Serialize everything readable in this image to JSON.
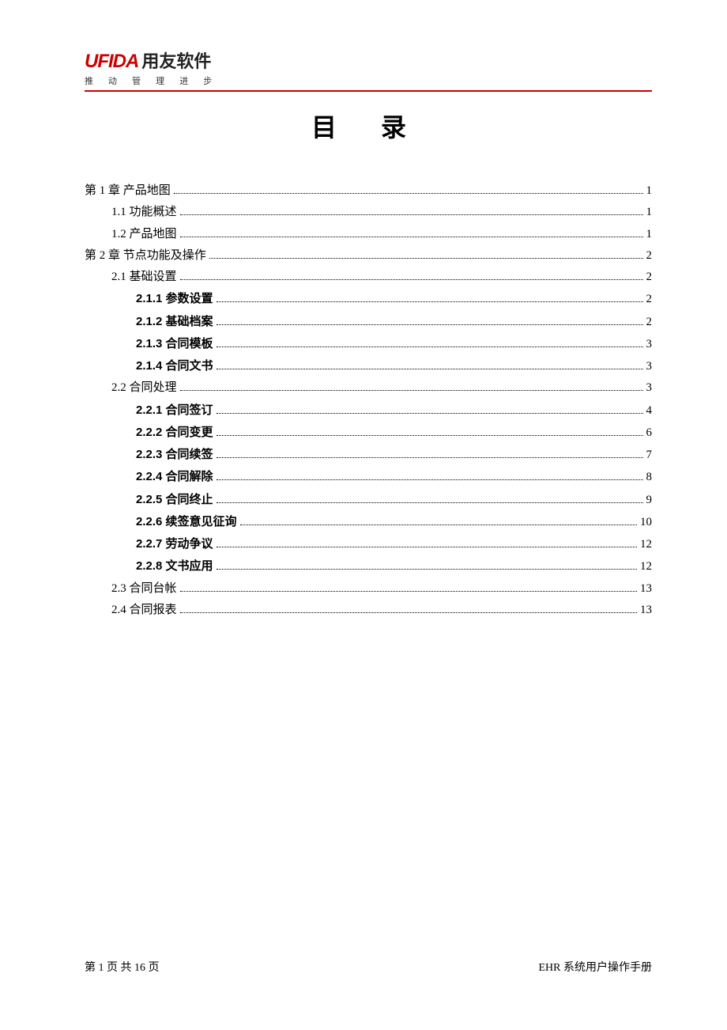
{
  "logo": {
    "en": "UFIDA",
    "cn": "用友软件",
    "subtitle": "推 动 管 理 进 步"
  },
  "title": "目 录",
  "toc": [
    {
      "level": 0,
      "label": "第 1 章  产品地图",
      "page": "1"
    },
    {
      "level": 1,
      "label": "1.1 功能概述",
      "page": "1"
    },
    {
      "level": 1,
      "label": "1.2 产品地图",
      "page": "1"
    },
    {
      "level": 0,
      "label": "第 2 章  节点功能及操作",
      "page": "2"
    },
    {
      "level": 1,
      "label": "2.1 基础设置",
      "page": "2"
    },
    {
      "level": 2,
      "label": "2.1.1 参数设置",
      "page": "2"
    },
    {
      "level": 2,
      "label": "2.1.2 基础档案",
      "page": "2"
    },
    {
      "level": 2,
      "label": "2.1.3 合同模板",
      "page": "3"
    },
    {
      "level": 2,
      "label": "2.1.4 合同文书",
      "page": "3"
    },
    {
      "level": 1,
      "label": "2.2 合同处理",
      "page": "3"
    },
    {
      "level": 2,
      "label": "2.2.1 合同签订",
      "page": "4"
    },
    {
      "level": 2,
      "label": "2.2.2 合同变更",
      "page": "6"
    },
    {
      "level": 2,
      "label": "2.2.3 合同续签",
      "page": "7"
    },
    {
      "level": 2,
      "label": "2.2.4 合同解除",
      "page": "8"
    },
    {
      "level": 2,
      "label": "2.2.5 合同终止",
      "page": "9"
    },
    {
      "level": 2,
      "label": "2.2.6 续签意见征询",
      "page": "10"
    },
    {
      "level": 2,
      "label": "2.2.7 劳动争议",
      "page": "12"
    },
    {
      "level": 2,
      "label": "2.2.8 文书应用",
      "page": "12"
    },
    {
      "level": 1,
      "label": "2.3 合同台帐",
      "page": "13"
    },
    {
      "level": 1,
      "label": "2.4 合同报表",
      "page": "13"
    }
  ],
  "footer": {
    "left": "第  1  页  共  16  页",
    "right": "EHR 系统用户操作手册"
  }
}
